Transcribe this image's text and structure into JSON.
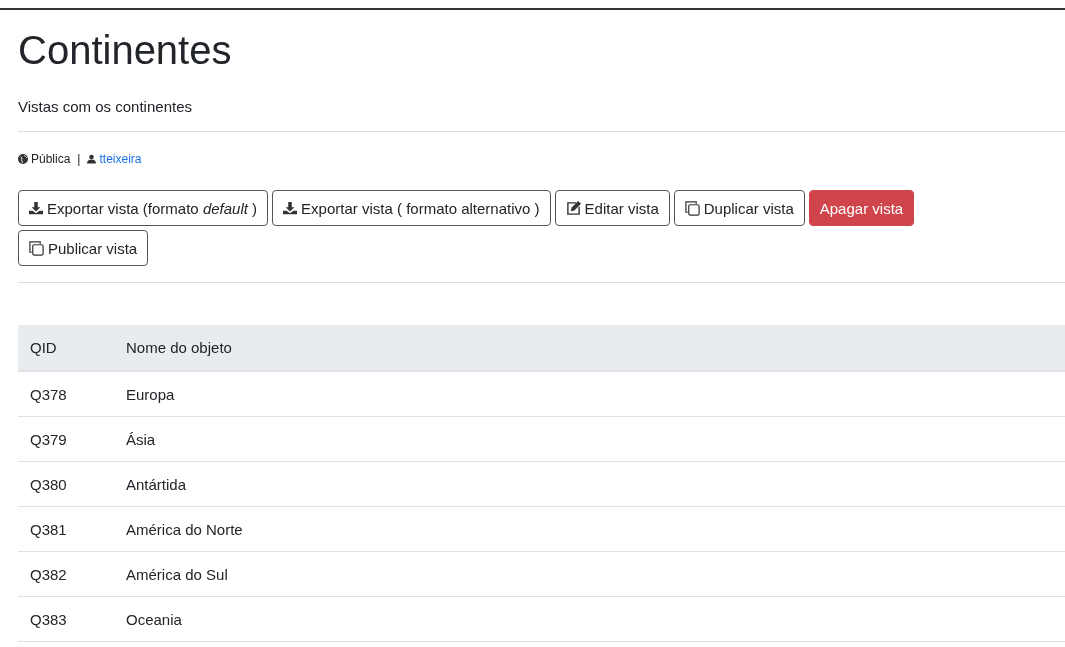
{
  "title": "Continentes",
  "description": "Vistas com os continentes",
  "meta": {
    "visibility": "Pública",
    "separator": "|",
    "author": "tteixeira"
  },
  "buttons": [
    {
      "label": "Exportar vista (formato *default* )",
      "kind": "download"
    },
    {
      "label": "Exportar vista ( formato alternativo )",
      "kind": "download"
    },
    {
      "label": "Editar vista",
      "kind": "edit"
    },
    {
      "label": "Duplicar vista",
      "kind": "copy"
    },
    {
      "label": "Apagar vista",
      "kind": "danger"
    },
    {
      "label": "Publicar vista",
      "kind": "copy"
    }
  ],
  "table": {
    "columns": [
      "QID",
      "Nome do objeto"
    ],
    "rows": [
      [
        "Q378",
        "Europa"
      ],
      [
        "Q379",
        "Ásia"
      ],
      [
        "Q380",
        "Antártida"
      ],
      [
        "Q381",
        "América do Norte"
      ],
      [
        "Q382",
        "América do Sul"
      ],
      [
        "Q383",
        "Oceania"
      ]
    ]
  }
}
